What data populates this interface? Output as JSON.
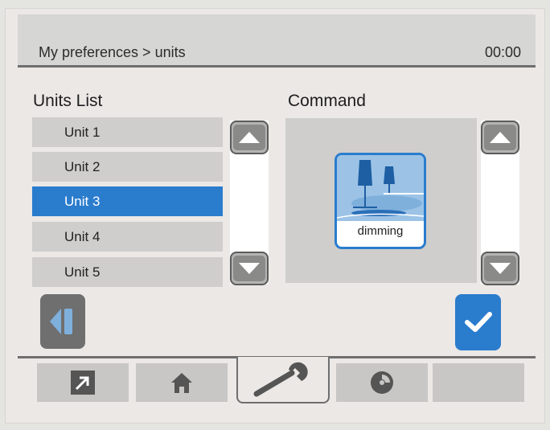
{
  "header": {
    "breadcrumb": "My preferences > units",
    "time": "00:00"
  },
  "units_list": {
    "title": "Units List",
    "items": [
      {
        "label": "Unit 1",
        "selected": false
      },
      {
        "label": "Unit 2",
        "selected": false
      },
      {
        "label": "Unit 3",
        "selected": true
      },
      {
        "label": "Unit 4",
        "selected": false
      },
      {
        "label": "Unit 5",
        "selected": false
      }
    ]
  },
  "command": {
    "title": "Command",
    "tile_label": "dimming",
    "tile_icon": "lamp-dimming-icon"
  },
  "buttons": {
    "back_icon": "back-icon",
    "confirm_icon": "check-icon"
  },
  "tabs": [
    {
      "icon": "shortcut-arrow-icon",
      "active": false
    },
    {
      "icon": "home-icon",
      "active": false
    },
    {
      "icon": "wrench-icon",
      "active": true
    },
    {
      "icon": "disc-icon",
      "active": false
    },
    {
      "icon": "",
      "active": false
    }
  ],
  "colors": {
    "accent": "#2a7ccd",
    "header_bg": "#d6d6d4",
    "panel_bg": "#ebe8e6",
    "row_bg": "#cfcecc"
  }
}
